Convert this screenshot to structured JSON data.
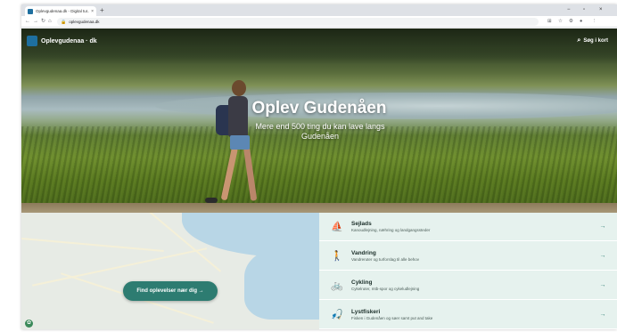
{
  "browser": {
    "tab_title": "Oplevgudenaa.dk - Digital tur...",
    "tab_close": "×",
    "new_tab": "+",
    "url": "oplevgudenaa.dk",
    "win_min": "−",
    "win_max": "▫",
    "win_close": "×",
    "favicon_color": "#1e6f9f"
  },
  "site": {
    "brand": "Oplevgudenaa · dk",
    "search_label": "Søg i kort"
  },
  "hero": {
    "title": "Oplev Gudenåen",
    "subtitle": "Mere end 500 ting du kan lave langs Gudenåen"
  },
  "map": {
    "button_label": "Find oplevelser nær dig →"
  },
  "activities": [
    {
      "icon": "kayak-icon",
      "glyph": "⛵",
      "title": "Sejlads",
      "desc": "Kanoudlejning, næhring og landgangssteder",
      "arrow": "→"
    },
    {
      "icon": "hiker-icon",
      "glyph": "🚶",
      "title": "Vandring",
      "desc": "Vandreruter og turforslag til alle behov",
      "arrow": "→"
    },
    {
      "icon": "bicycle-icon",
      "glyph": "🚲",
      "title": "Cykling",
      "desc": "Cykelruter, mtb-spor og cykeludlejning",
      "arrow": "→"
    },
    {
      "icon": "fishing-icon",
      "glyph": "🎣",
      "title": "Lystfiskeri",
      "desc": "Fisken i Gudenåen og søer samt put and take",
      "arrow": "→"
    }
  ],
  "colors": {
    "accent": "#2d7c71",
    "panel": "#e6f2ee"
  }
}
